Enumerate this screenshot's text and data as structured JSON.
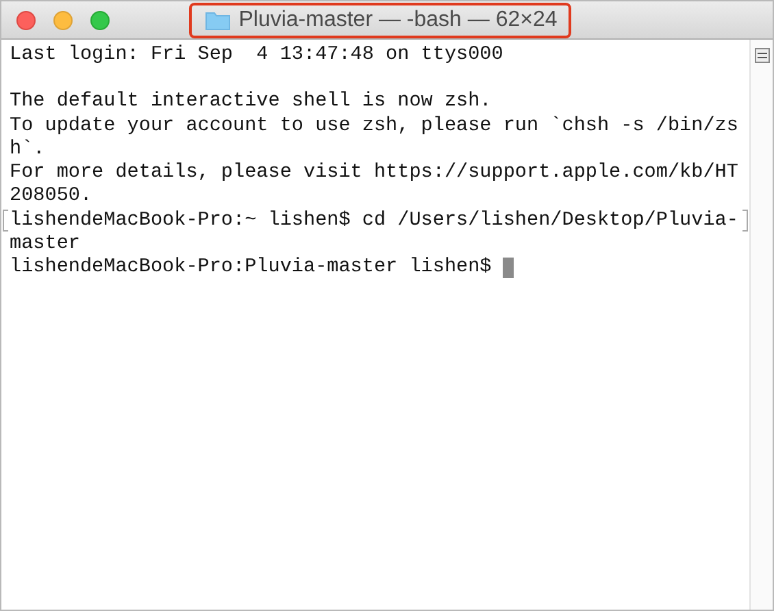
{
  "window": {
    "title": "Pluvia-master — -bash — 62×24",
    "title_highlighted": true
  },
  "terminal": {
    "cursor": true,
    "lines": [
      {
        "kind": "text",
        "text": "Last login: Fri Sep  4 13:47:48 on ttys000",
        "marked": false
      },
      {
        "kind": "blank"
      },
      {
        "kind": "text",
        "text": "The default interactive shell is now zsh.",
        "marked": false
      },
      {
        "kind": "text",
        "text": "To update your account to use zsh, please run `chsh -s /bin/zs",
        "marked": false
      },
      {
        "kind": "text",
        "text": "h`.",
        "marked": false
      },
      {
        "kind": "text",
        "text": "For more details, please visit https://support.apple.com/kb/HT",
        "marked": false
      },
      {
        "kind": "text",
        "text": "208050.",
        "marked": false
      },
      {
        "kind": "text",
        "text": "lishendeMacBook-Pro:~ lishen$ cd /Users/lishen/Desktop/Pluvia-",
        "marked": true
      },
      {
        "kind": "text",
        "text": "master",
        "marked": false
      },
      {
        "kind": "text",
        "text": "lishendeMacBook-Pro:Pluvia-master lishen$ ",
        "marked": false
      }
    ]
  }
}
